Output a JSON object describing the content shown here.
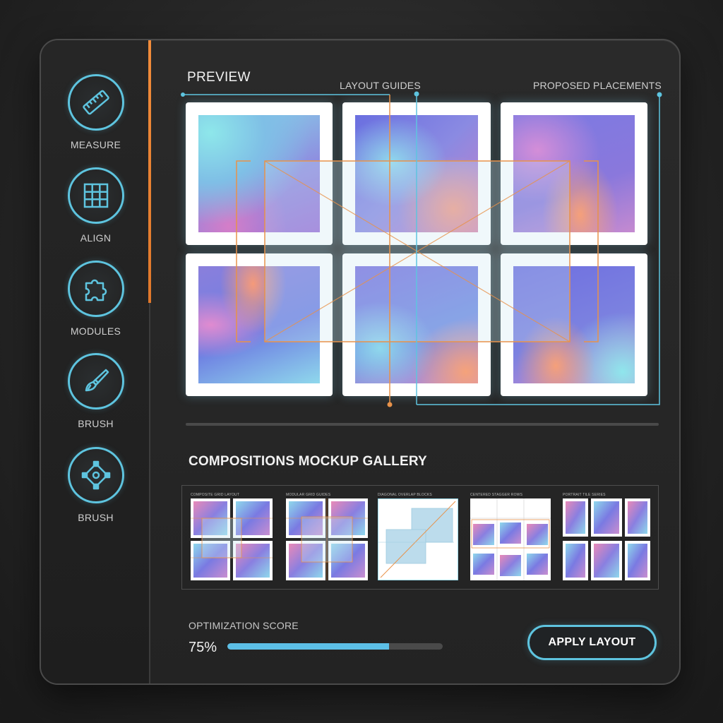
{
  "sidebar": {
    "tools": [
      {
        "label": "MEASURE",
        "icon": "ruler-icon"
      },
      {
        "label": "ALIGN",
        "icon": "grid-icon"
      },
      {
        "label": "MODULES",
        "icon": "puzzle-icon"
      },
      {
        "label": "BRUSH",
        "icon": "brush-icon"
      },
      {
        "label": "BRUSH",
        "icon": "transform-icon"
      }
    ]
  },
  "preview": {
    "title": "PREVIEW",
    "layout_guides_label": "LAYOUT GUIDES",
    "proposed_placements_label": "PROPOSED PLACEMENTS"
  },
  "gallery": {
    "title": "COMPOSITIONS MOCKUP GALLERY",
    "thumbnails": [
      {
        "caption": "COMPOSITE GRID LAYOUT"
      },
      {
        "caption": "MODULAR GRID GUIDES"
      },
      {
        "caption": "DIAGONAL OVERLAP BLOCKS"
      },
      {
        "caption": "CENTERED STAGGER ROWS"
      },
      {
        "caption": "PORTRAIT TILE SERIES"
      }
    ]
  },
  "optimization": {
    "label": "OPTIMIZATION SCORE",
    "value_text": "75%",
    "value": 0.75
  },
  "actions": {
    "apply_label": "APPLY LAYOUT"
  },
  "colors": {
    "accent_blue": "#5ec4df",
    "accent_orange": "#f28c3b",
    "background": "#232323"
  }
}
